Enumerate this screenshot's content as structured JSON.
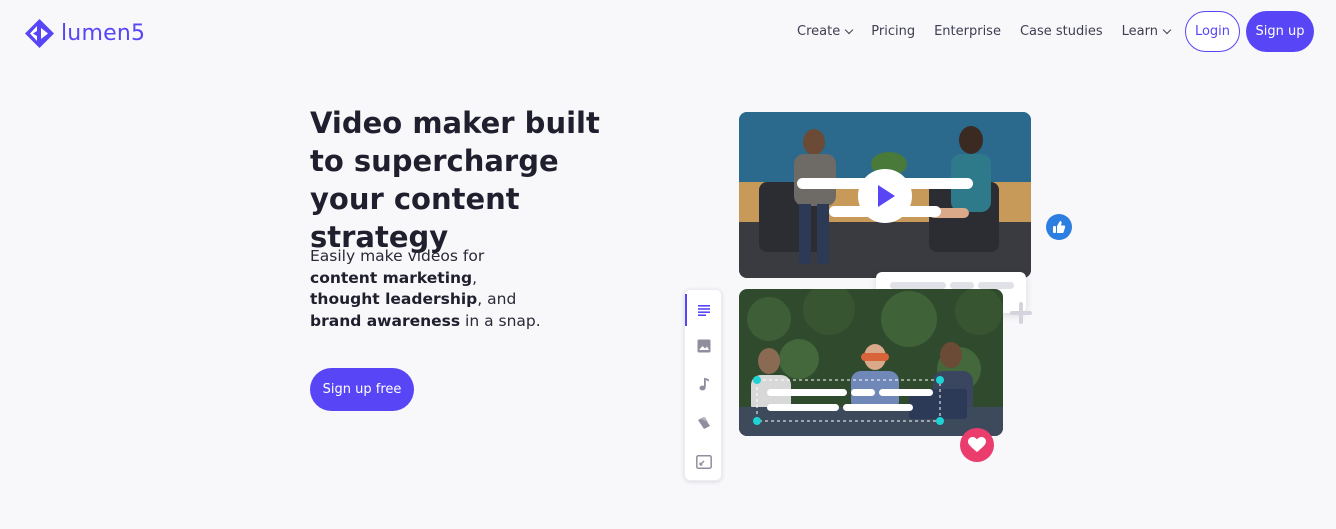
{
  "brand": {
    "name": "lumen5",
    "accent": "#5846f6"
  },
  "nav": {
    "items": [
      {
        "label": "Create",
        "dropdown": true
      },
      {
        "label": "Pricing",
        "dropdown": false
      },
      {
        "label": "Enterprise",
        "dropdown": false
      },
      {
        "label": "Case studies",
        "dropdown": false
      },
      {
        "label": "Learn",
        "dropdown": true
      }
    ],
    "login_label": "Login",
    "signup_label": "Sign up"
  },
  "hero": {
    "title": "Video maker built to supercharge your content strategy",
    "subtitle_intro": "Easily make videos for",
    "subtitle_b1": "content marketing",
    "subtitle_p1": ",",
    "subtitle_b2": "thought leadership",
    "subtitle_p2": ", and",
    "subtitle_b3": "brand awareness",
    "subtitle_p3": " in a snap.",
    "cta_label": "Sign up free"
  },
  "illustration": {
    "toolbar_icons": [
      "text-icon",
      "image-icon",
      "music-icon",
      "color-icon",
      "resize-icon"
    ],
    "like_color": "#2c7fe0",
    "heart_color": "#ea3d6e"
  }
}
